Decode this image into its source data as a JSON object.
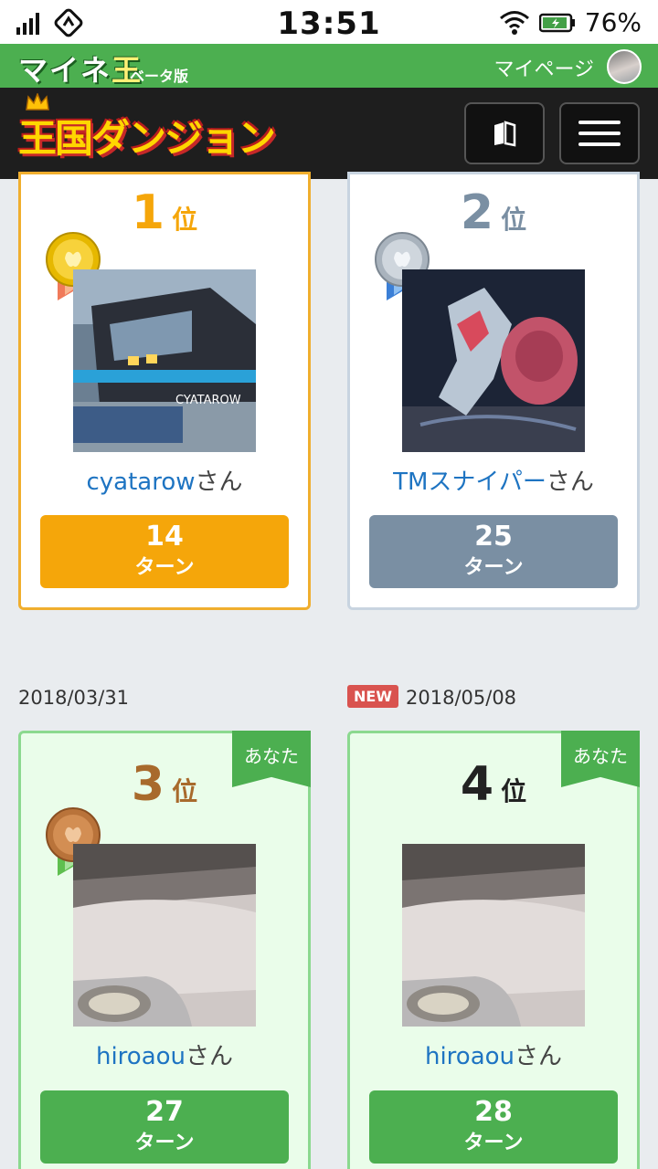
{
  "status_bar": {
    "time": "13:51",
    "battery": "76%"
  },
  "mine_bar": {
    "logo_a": "マイ",
    "logo_b": "ネ",
    "logo_c": "王",
    "beta": "ベータ版",
    "mypage": "マイページ"
  },
  "header": {
    "logo": "王国ダンジョン"
  },
  "cards": [
    {
      "rank": "1",
      "rank_unit": "位",
      "name": "cyatarow",
      "suffix": "さん",
      "turns": "14",
      "turn_label": "ターン",
      "thumb_text": "CYATAROW"
    },
    {
      "rank": "2",
      "rank_unit": "位",
      "name": "TMスナイパー",
      "suffix": "さん",
      "turns": "25",
      "turn_label": "ターン"
    },
    {
      "rank": "3",
      "rank_unit": "位",
      "name": "hiroaou",
      "suffix": "さん",
      "turns": "27",
      "turn_label": "ターン",
      "you": "あなた",
      "date": "2018/03/31"
    },
    {
      "rank": "4",
      "rank_unit": "位",
      "name": "hiroaou",
      "suffix": "さん",
      "turns": "28",
      "turn_label": "ターン",
      "you": "あなた",
      "date": "2018/05/08",
      "badge": "NEW"
    }
  ],
  "colors": {
    "gold": "#f5a60a",
    "silver": "#7a8fa3",
    "bronze": "#a86a2c",
    "green": "#4caf50",
    "link": "#1e74c2"
  }
}
